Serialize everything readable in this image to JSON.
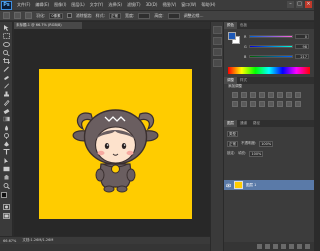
{
  "app": {
    "logo": "Ps"
  },
  "menu": [
    "文件(F)",
    "编辑(E)",
    "图像(I)",
    "图层(L)",
    "文字(Y)",
    "选择(S)",
    "滤镜(T)",
    "3D(D)",
    "视图(V)",
    "窗口(W)",
    "帮助(H)"
  ],
  "window_controls": [
    "–",
    "□",
    "×"
  ],
  "options": {
    "feather_label": "羽化:",
    "feather_value": "0像素",
    "antialias_label": "消除锯齿",
    "style_label": "样式:",
    "style_value": "正常",
    "width_label": "宽度:",
    "height_label": "高度:",
    "refine_label": "调整边缘..."
  },
  "document": {
    "tab_title": "未标题-1 @ 66.7% (RGB/8)"
  },
  "status": {
    "zoom": "66.67%",
    "doc_info": "文档:1.26M/1.26M"
  },
  "color_panel": {
    "tabs": [
      "颜色",
      "色板"
    ],
    "sliders": [
      {
        "letter": "R",
        "value": "0"
      },
      {
        "letter": "G",
        "value": "98"
      },
      {
        "letter": "B",
        "value": "217"
      }
    ]
  },
  "adjustments_panel": {
    "tabs": [
      "调整",
      "样式"
    ],
    "title": "添加调整"
  },
  "layers_panel": {
    "tabs": [
      "图层",
      "通道",
      "路径"
    ],
    "kind_label": "类型",
    "blend_mode": "正常",
    "opacity_label": "不透明度:",
    "opacity_value": "100%",
    "lock_label": "锁定:",
    "fill_label": "填充:",
    "fill_value": "100%",
    "layers": [
      {
        "name": "图层 1"
      }
    ]
  },
  "colors": {
    "canvas": "#ffcc00",
    "foreground": "#1d58b6",
    "background": "#ffffff",
    "layer_selected": "#5a7aa8"
  }
}
